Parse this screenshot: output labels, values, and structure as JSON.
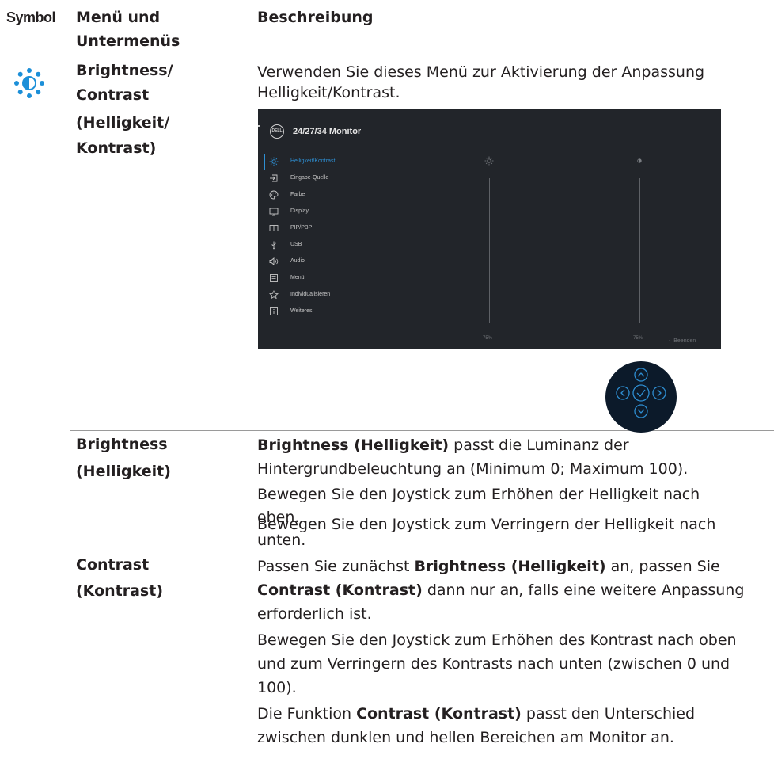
{
  "header": {
    "symbol": "Symbol",
    "menu": "Menü und",
    "menu2": "Untermenüs",
    "description": "Beschreibung"
  },
  "row_main": {
    "icon": "brightness-contrast-icon",
    "menu_lines": [
      "Brightness/",
      "Contrast",
      "(Helligkeit/",
      "Kontrast)"
    ],
    "description_lines": [
      "Verwenden Sie dieses Menü zur Aktivierung der Anpassung",
      "Helligkeit/Kontrast."
    ]
  },
  "osd": {
    "logo": "DELL",
    "title": "24/27/34 Monitor",
    "menu_items": [
      {
        "label": "Helligkeit/Kontrast",
        "icon": "sun-icon",
        "active": true
      },
      {
        "label": "Eingabe-Quelle",
        "icon": "input-icon"
      },
      {
        "label": "Farbe",
        "icon": "palette-icon"
      },
      {
        "label": "Display",
        "icon": "monitor-icon"
      },
      {
        "label": "PIP/PBP",
        "icon": "pip-icon"
      },
      {
        "label": "USB",
        "icon": "usb-icon"
      },
      {
        "label": "Audio",
        "icon": "speaker-icon"
      },
      {
        "label": "Menü",
        "icon": "menu-icon"
      },
      {
        "label": "Individualisieren",
        "icon": "star-icon"
      },
      {
        "label": "Weiteres",
        "icon": "info-icon"
      }
    ],
    "brightness_value": "75%",
    "brightness_level": 0.75,
    "contrast_value": "75%",
    "contrast_level": 0.75,
    "exit_label": "Beenden",
    "accent": "#2e8fd3"
  },
  "row_brightness": {
    "menu_lines": [
      "Brightness",
      "(Helligkeit)"
    ],
    "p1_bold": "Brightness (Helligkeit)",
    "p1_rest_a": " passt die Luminanz der",
    "p1_line2": "Hintergrundbeleuchtung an (Minimum 0; Maximum 100).",
    "p2_lines": [
      "Bewegen Sie den Joystick zum Erhöhen der Helligkeit nach",
      "oben."
    ],
    "p3_lines": [
      "Bewegen Sie den Joystick zum Verringern der Helligkeit nach",
      "unten."
    ]
  },
  "row_contrast": {
    "menu_lines": [
      "Contrast",
      "(Kontrast)"
    ],
    "p1_a": "Passen Sie zunächst ",
    "p1_b": "Brightness (Helligkeit)",
    "p1_c": " an, passen Sie",
    "p1_d": "Contrast (Kontrast)",
    "p1_e": " dann nur an, falls eine weitere Anpassung",
    "p1_f": "erforderlich ist.",
    "p2_lines": [
      "Bewegen Sie den Joystick zum Erhöhen des Kontrast nach oben",
      "und zum Verringern des Kontrasts nach unten (zwischen 0 und",
      "100)."
    ],
    "p3_a": "Die Funktion ",
    "p3_b": "Contrast (Kontrast)",
    "p3_c": " passt den Unterschied",
    "p3_line2": "zwischen dunklen und hellen Bereichen am Monitor an."
  }
}
